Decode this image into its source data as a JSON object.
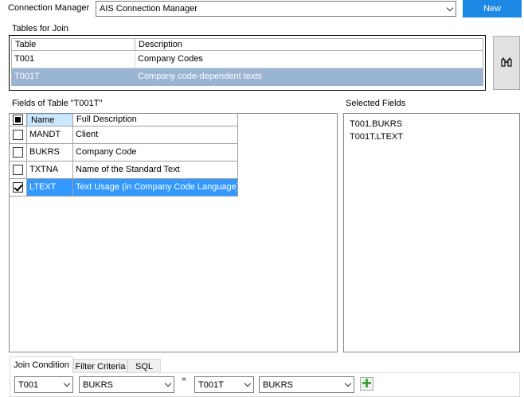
{
  "connection": {
    "label": "Connection Manager",
    "selected": "AIS Connection Manager",
    "new_button": "New"
  },
  "tables_for_join": {
    "label": "Tables for Join",
    "columns": [
      "Table",
      "Description"
    ],
    "rows": [
      {
        "table": "T001",
        "description": "Company Codes"
      },
      {
        "table": "T001T",
        "description": "Company code-dependent texts"
      }
    ],
    "search_icon": "binoculars-icon"
  },
  "fields": {
    "label": "Fields of Table \"T001T\"",
    "columns": [
      "Name",
      "Full Description"
    ],
    "rows": [
      {
        "name": "MANDT",
        "description": "Client",
        "checked": false
      },
      {
        "name": "BUKRS",
        "description": "Company Code",
        "checked": false
      },
      {
        "name": "TXTNA",
        "description": "Name of the Standard Text",
        "checked": false
      },
      {
        "name": "LTEXT",
        "description": "Text Usage (in Company Code Language)",
        "checked": true
      }
    ]
  },
  "selected_fields": {
    "label": "Selected Fields",
    "items": [
      "T001.BUKRS",
      "T001T.LTEXT"
    ]
  },
  "tabs": [
    "Join Condition",
    "Filter Criteria",
    "SQL"
  ],
  "join": {
    "left_table": "T001",
    "left_field": "BUKRS",
    "operator": "=",
    "right_table": "T001T",
    "right_field": "BUKRS",
    "add_icon": "plus-icon"
  },
  "colors": {
    "accent": "#1e88e5",
    "row_selected_inactive": "#99b4d1",
    "row_selected_active": "#3399ff",
    "add_green": "#2e9e2e"
  }
}
